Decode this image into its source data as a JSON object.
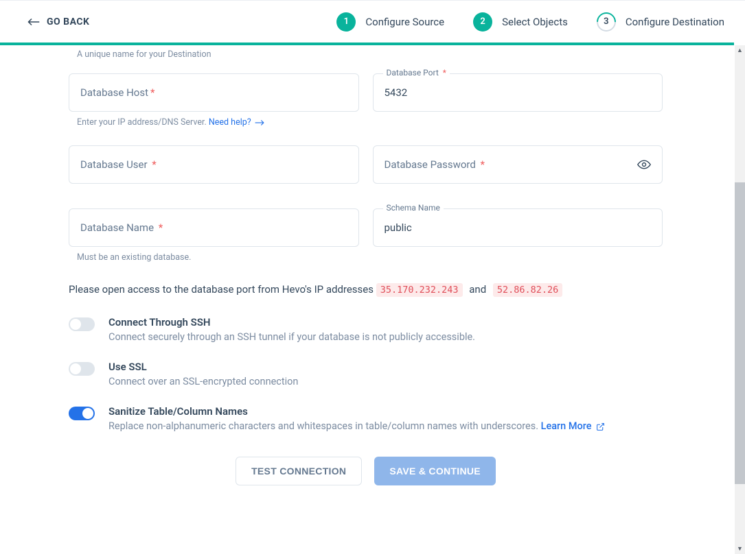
{
  "header": {
    "goback": "GO BACK",
    "steps": [
      {
        "num": "1",
        "label": "Configure Source",
        "state": "done"
      },
      {
        "num": "2",
        "label": "Select Objects",
        "state": "done"
      },
      {
        "num": "3",
        "label": "Configure Destination",
        "state": "active"
      }
    ]
  },
  "form": {
    "dest_hint": "A unique name for your Destination",
    "host_label": "Database Host",
    "host_helper_pre": "Enter your IP address/DNS Server. ",
    "host_helper_link": "Need help?",
    "port_label": "Database Port",
    "port_value": "5432",
    "user_label": "Database User",
    "password_label": "Database Password",
    "dbname_label": "Database Name",
    "dbname_helper": "Must be an existing database.",
    "schema_label": "Schema Name",
    "schema_value": "public",
    "ip_note_pre": "Please open access to the database port from Hevo's IP addresses ",
    "ip1": "35.170.232.243",
    "ip_and": "and",
    "ip2": "52.86.82.26",
    "toggles": {
      "ssh_title": "Connect Through SSH",
      "ssh_desc": "Connect securely through an SSH tunnel if your database is not publicly accessible.",
      "ssl_title": "Use SSL",
      "ssl_desc": "Connect over an SSL-encrypted connection",
      "sanitize_title": "Sanitize Table/Column Names",
      "sanitize_desc": "Replace non-alphanumeric characters and whitespaces in table/column names with underscores. ",
      "sanitize_link": "Learn More"
    },
    "actions": {
      "test": "TEST CONNECTION",
      "save": "SAVE & CONTINUE"
    }
  }
}
